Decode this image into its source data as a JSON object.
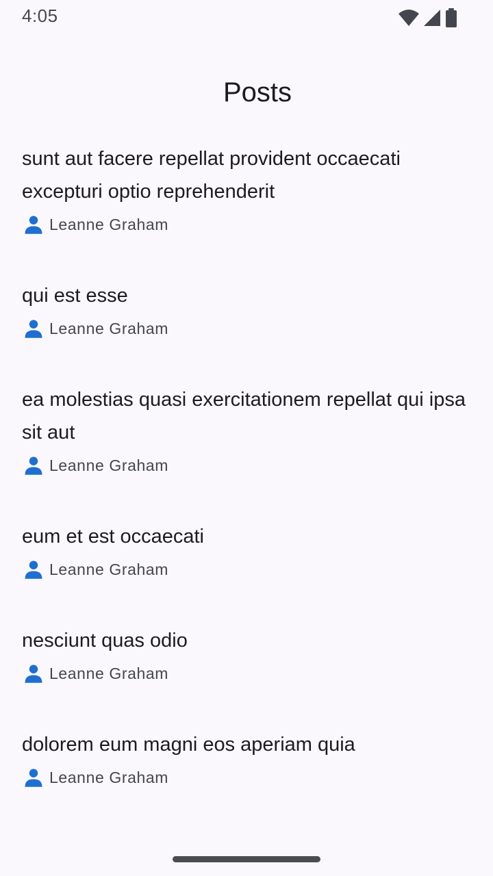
{
  "status_bar": {
    "time": "4:05",
    "icons": [
      "wifi-icon",
      "cellular-signal-icon",
      "battery-icon"
    ]
  },
  "app_bar": {
    "title": "Posts"
  },
  "posts": [
    {
      "title": "sunt aut facere repellat provident occaecati excepturi optio reprehenderit",
      "author": "Leanne Graham"
    },
    {
      "title": "qui est esse",
      "author": "Leanne Graham"
    },
    {
      "title": "ea molestias quasi exercitationem repellat qui ipsa sit aut",
      "author": "Leanne Graham"
    },
    {
      "title": "eum et est occaecati",
      "author": "Leanne Graham"
    },
    {
      "title": "nesciunt quas odio",
      "author": "Leanne Graham"
    },
    {
      "title": "dolorem eum magni eos aperiam quia",
      "author": "Leanne Graham"
    }
  ],
  "colors": {
    "background": "#fbf8fd",
    "text_primary": "#1b1b21",
    "text_secondary": "#44464f",
    "author_icon": "#1e6fd0"
  }
}
